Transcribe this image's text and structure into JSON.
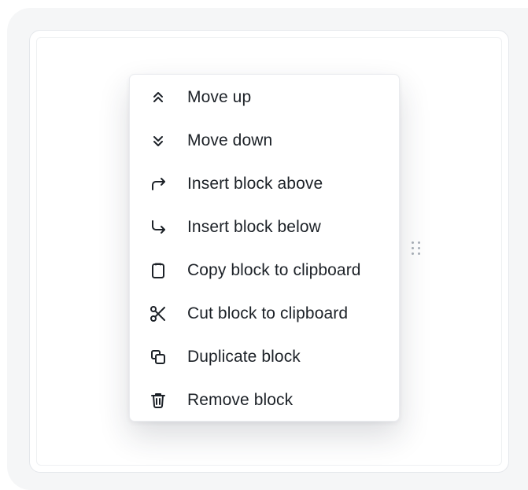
{
  "menu": {
    "items": [
      {
        "label": "Move up",
        "icon": "chevrons-up-icon"
      },
      {
        "label": "Move down",
        "icon": "chevrons-down-icon"
      },
      {
        "label": "Insert block above",
        "icon": "corner-up-right-icon"
      },
      {
        "label": "Insert block below",
        "icon": "corner-down-right-icon"
      },
      {
        "label": "Copy block to clipboard",
        "icon": "clipboard-icon"
      },
      {
        "label": "Cut block to clipboard",
        "icon": "scissors-icon"
      },
      {
        "label": "Duplicate block",
        "icon": "copy-icon"
      },
      {
        "label": "Remove block",
        "icon": "trash-icon"
      }
    ]
  },
  "colors": {
    "text": "#1c2127",
    "menu_background": "#ffffff",
    "outer_background": "#f5f6f7",
    "handle_dots": "#a9afb8"
  }
}
